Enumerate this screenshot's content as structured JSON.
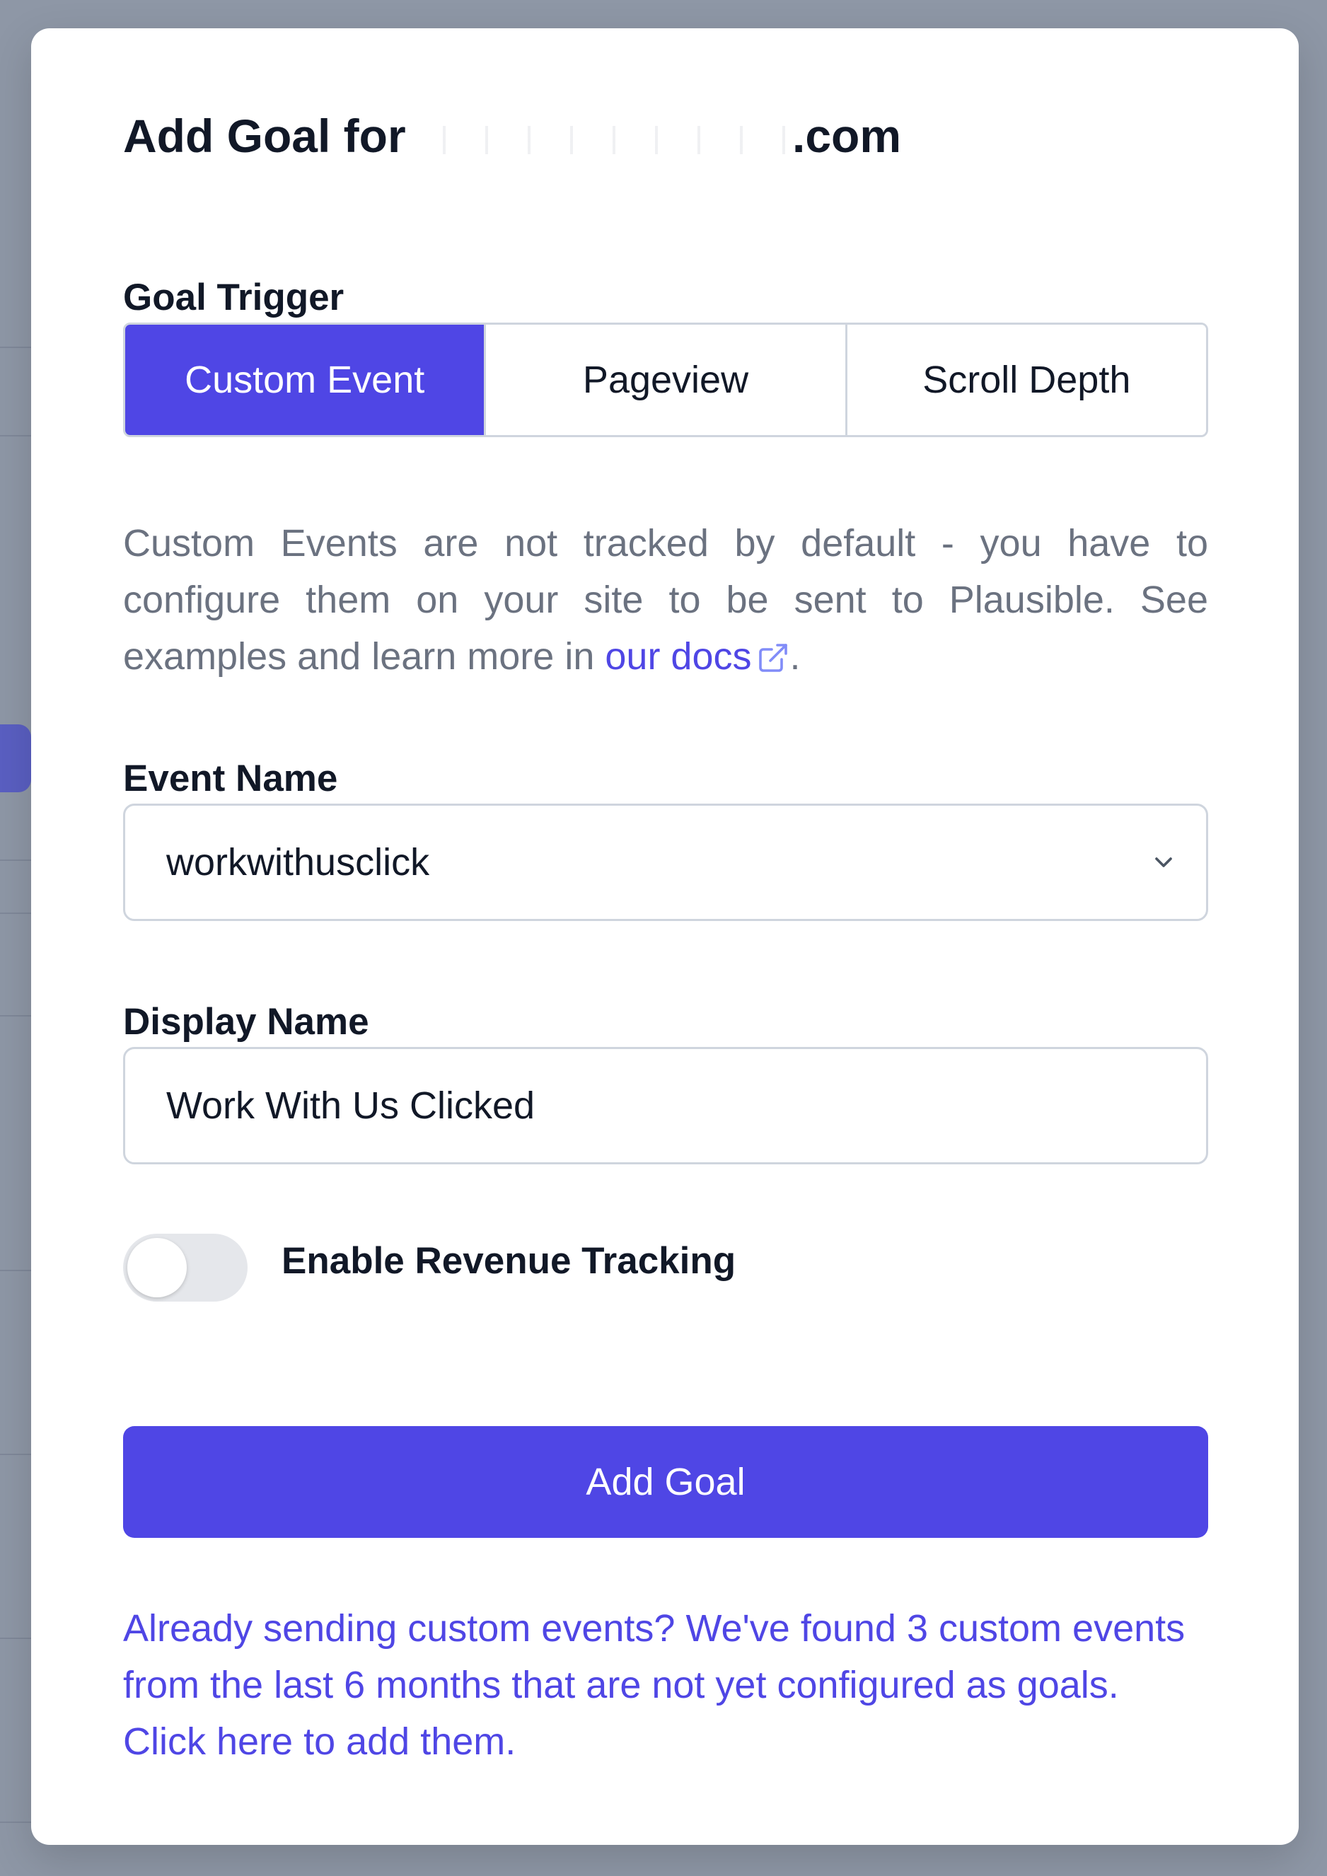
{
  "modal": {
    "title_prefix": "Add Goal for",
    "title_suffix": ".com",
    "goal_trigger": {
      "label": "Goal Trigger",
      "options": [
        {
          "label": "Custom Event",
          "active": true
        },
        {
          "label": "Pageview",
          "active": false
        },
        {
          "label": "Scroll Depth",
          "active": false
        }
      ]
    },
    "help": {
      "text": "Custom Events are not tracked by default - you have to configure them on your site to be sent to Plausible. See examples and learn more in",
      "link_text": "our docs",
      "suffix": "."
    },
    "event_name": {
      "label": "Event Name",
      "value": "workwithusclick"
    },
    "display_name": {
      "label": "Display Name",
      "value": "Work With Us Clicked"
    },
    "revenue": {
      "label": "Enable Revenue Tracking",
      "enabled": false
    },
    "submit_label": "Add Goal",
    "footer_link": "Already sending custom events? We've found 3 custom events from the last 6 months that are not yet configured as goals. Click here to add them."
  },
  "icons": {
    "external_link": "external-link-icon",
    "dropdown": "chevron-down-icon"
  },
  "colors": {
    "accent": "#4f46e5",
    "overlay": "#8e97a6",
    "muted_text": "#6b7280",
    "border": "#cfd5de",
    "toggle_off": "#e5e7eb"
  }
}
